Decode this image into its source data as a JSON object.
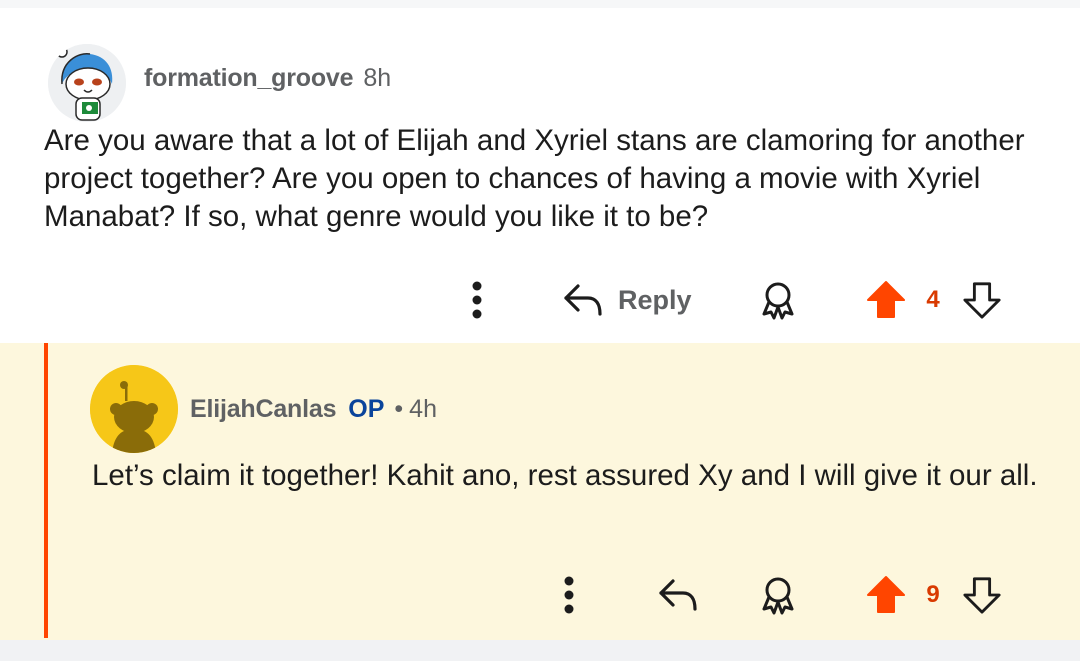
{
  "parent_comment": {
    "username": "formation_groove",
    "age": "8h",
    "body": "Are you aware that a lot of Elijah and Xyriel stans are clamoring for another project together? Are you open to chances of having a movie with Xyriel Manabat? If so, what genre would you like it to be?",
    "reply_label": "Reply",
    "vote_count": "4"
  },
  "reply_comment": {
    "username": "ElijahCanlas",
    "op_badge": "OP",
    "separator": "•",
    "age": "4h",
    "body": "Let’s claim it together! Kahit ano, rest assured Xy and I will give it our all.",
    "vote_count": "9"
  },
  "colors": {
    "upvote_active": "#ff4500",
    "thread_line": "#ff4500",
    "reply_background": "#fdf7dd",
    "op_badge": "#0a449b",
    "meta_text": "#5f6163"
  },
  "icons": {
    "more": "more-options-icon",
    "reply": "reply-arrow-icon",
    "award": "award-icon",
    "upvote": "upvote-arrow-icon",
    "downvote": "downvote-arrow-icon"
  }
}
